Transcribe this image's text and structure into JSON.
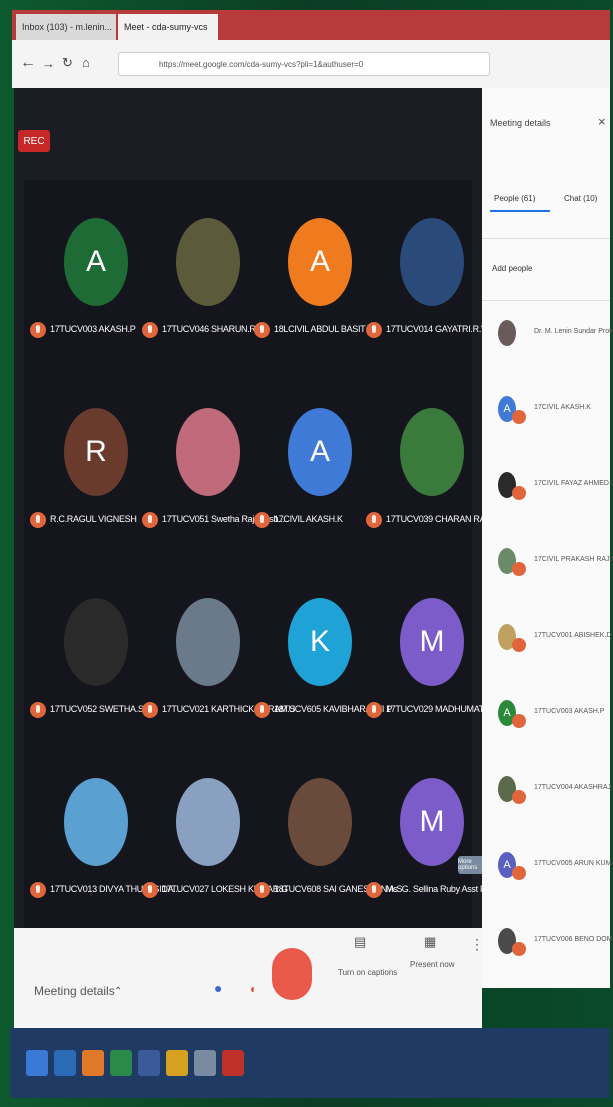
{
  "browser": {
    "tabs": [
      {
        "label": "Inbox (103) - m.lenin...",
        "active": false
      },
      {
        "label": "Meet - cda-sumy-vcs",
        "active": true
      }
    ],
    "url": "https://meet.google.com/cda-sumy-vcs?pli=1&authuser=0"
  },
  "meet": {
    "rec_label": "REC",
    "participants": [
      {
        "name": "17TUCV003 AKASH.P",
        "initial": "A",
        "color": "#1f6b35"
      },
      {
        "name": "17TUCV046 SHARUN.R",
        "initial": "",
        "color": "#5b5a3a"
      },
      {
        "name": "18LCIVIL ABDUL BASIT",
        "initial": "A",
        "color": "#f07a1e"
      },
      {
        "name": "17TUCV014 GAYATRI.R.V",
        "initial": "",
        "color": "#2a4a7a"
      },
      {
        "name": "R.C.RAGUL VIGNESH",
        "initial": "R",
        "color": "#6a3a2c"
      },
      {
        "name": "17TUCV051 Swetha Rajalaksh...",
        "initial": "",
        "color": "#c06a7a"
      },
      {
        "name": "17CIVIL AKASH.K",
        "initial": "A",
        "color": "#3f7ad6"
      },
      {
        "name": "17TUCV039 CHARAN RAJ.N.M",
        "initial": "",
        "color": "#3a7a3a"
      },
      {
        "name": "17TUCV052 SWETHA.S",
        "initial": "",
        "color": "#2a2a2a"
      },
      {
        "name": "17TUCV021 KARTHICKSRIRAM.S",
        "initial": "",
        "color": "#6a7a8a"
      },
      {
        "name": "18TUCV605 KAVIBHARATHI P",
        "initial": "K",
        "color": "#1fa3d6"
      },
      {
        "name": "17TUCV029 MADHUMATHI.P",
        "initial": "M",
        "color": "#7b5cc9"
      },
      {
        "name": "17TUCV013 DIVYA THULASIDA...",
        "initial": "",
        "color": "#5aa0d0"
      },
      {
        "name": "17TUCV027 LOKESH KUMAR.G",
        "initial": "",
        "color": "#8aa0c0"
      },
      {
        "name": "18TUCV608 SAI GANESHAN A.S",
        "initial": "",
        "color": "#6a4a3a"
      },
      {
        "name": "Ms. G. Sellina Ruby Asst Pr...",
        "initial": "M",
        "color": "#7b5cc9"
      }
    ],
    "more_options": "More options",
    "meeting_details": "Meeting details",
    "turn_on_captions": "Turn on captions",
    "present_now": "Present now"
  },
  "panel": {
    "title": "Meeting details",
    "people_tab": "People (61)",
    "chat_tab": "Chat (10)",
    "add_people": "Add people",
    "people": [
      {
        "name": "Dr. M. Lenin Sundar Professor ...",
        "initial": "",
        "color": "#6a5a5a"
      },
      {
        "name": "17CIVIL AKASH.K",
        "initial": "A",
        "color": "#3f7ad6"
      },
      {
        "name": "17CIVIL FAYAZ AHMED.S.M",
        "initial": "",
        "color": "#2a2a2a"
      },
      {
        "name": "17CIVIL PRAKASH RAJ.K",
        "initial": "",
        "color": "#6a8a6a"
      },
      {
        "name": "17TUCV001 ABISHEK.D",
        "initial": "",
        "color": "#c0a060"
      },
      {
        "name": "17TUCV003 AKASH.P",
        "initial": "A",
        "color": "#2a8a3a"
      },
      {
        "name": "17TUCV004 AKASHRAJ.R",
        "initial": "",
        "color": "#5a6a4a"
      },
      {
        "name": "17TUCV005 ARUN KUMAR.N",
        "initial": "A",
        "color": "#5a60c0"
      },
      {
        "name": "17TUCV006 BENO DOMINIC.J",
        "initial": "",
        "color": "#4a4a4a"
      }
    ]
  }
}
